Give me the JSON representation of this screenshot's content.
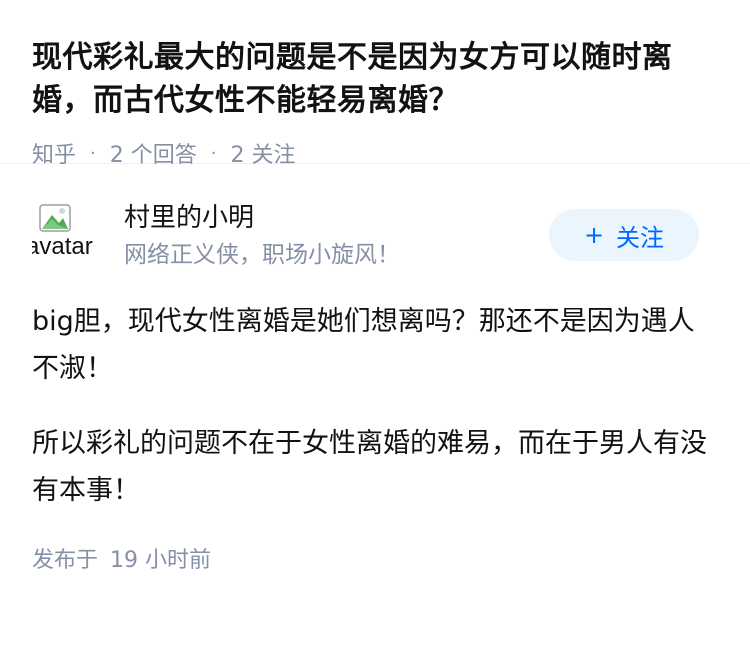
{
  "question": {
    "title": "现代彩礼最大的问题是不是因为女方可以随时离婚，而古代女性不能轻易离婚？",
    "source": "知乎",
    "answers": "2 个回答",
    "follows": "2 关注"
  },
  "answer": {
    "author": {
      "avatar_alt": "avatar",
      "name": "村里的小明",
      "bio": "网络正义侠，职场小旋风！"
    },
    "follow_button": {
      "icon": "+",
      "label": "关注"
    },
    "paragraphs": [
      "big胆，现代女性离婚是她们想离吗？那还不是因为遇人不淑！",
      "所以彩礼的问题不在于女性离婚的难易，而在于男人有没有本事！"
    ],
    "publish_label": "发布于",
    "publish_time": "19 小时前"
  },
  "colors": {
    "accent": "#0066ff",
    "accent_bg": "#ebf5fd",
    "meta": "#8590a6",
    "text": "#121212"
  }
}
